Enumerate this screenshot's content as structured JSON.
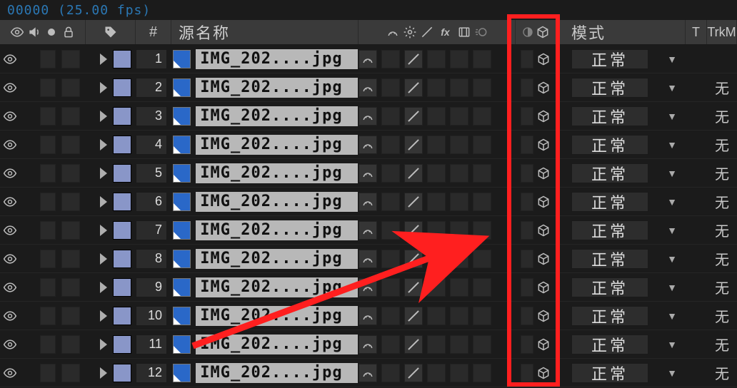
{
  "frame_info": "00000 (25.00 fps)",
  "header": {
    "hash": "#",
    "source_name": "源名称",
    "mode": "模式",
    "t": "T",
    "trk": "TrkM"
  },
  "mode_value": "正常",
  "trk_value": "无",
  "layers": [
    {
      "index": 1,
      "name": "IMG_202....jpg",
      "show_trk": false
    },
    {
      "index": 2,
      "name": "IMG_202....jpg",
      "show_trk": true
    },
    {
      "index": 3,
      "name": "IMG_202....jpg",
      "show_trk": true
    },
    {
      "index": 4,
      "name": "IMG_202....jpg",
      "show_trk": true
    },
    {
      "index": 5,
      "name": "IMG_202....jpg",
      "show_trk": true
    },
    {
      "index": 6,
      "name": "IMG_202....jpg",
      "show_trk": true
    },
    {
      "index": 7,
      "name": "IMG_202....jpg",
      "show_trk": true
    },
    {
      "index": 8,
      "name": "IMG_202....jpg",
      "show_trk": true
    },
    {
      "index": 9,
      "name": "IMG_202....jpg",
      "show_trk": true
    },
    {
      "index": 10,
      "name": "IMG_202....jpg",
      "show_trk": true
    },
    {
      "index": 11,
      "name": "IMG_202....jpg",
      "show_trk": true
    },
    {
      "index": 12,
      "name": "IMG_202....jpg",
      "show_trk": true
    }
  ]
}
